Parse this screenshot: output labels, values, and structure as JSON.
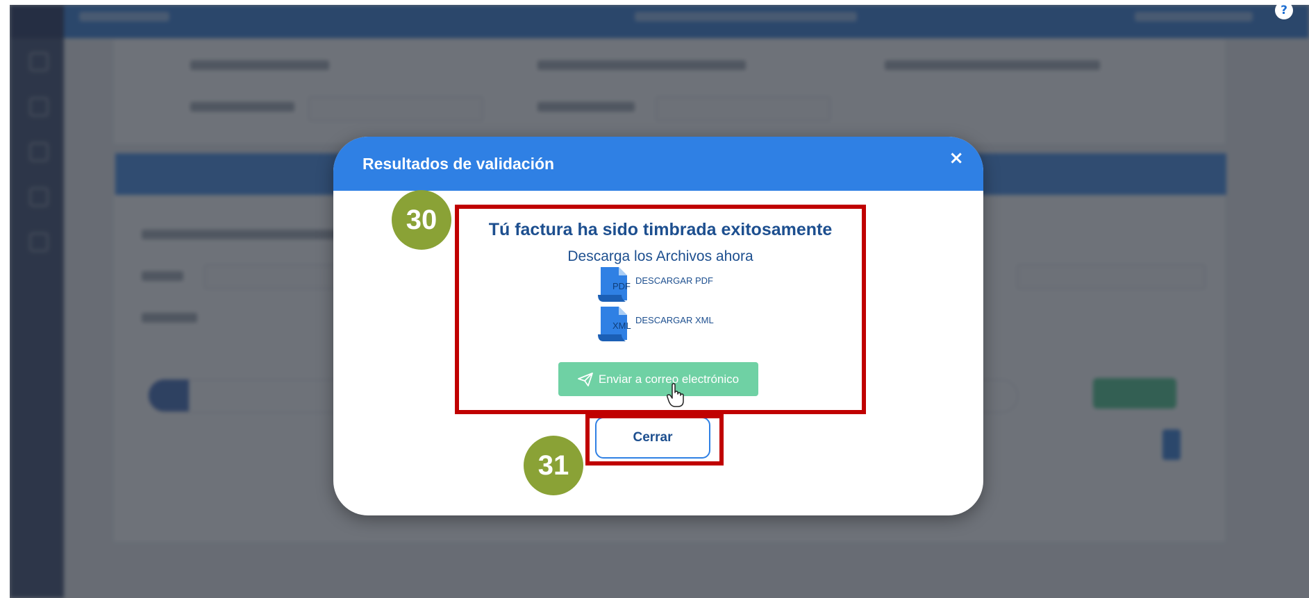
{
  "modal": {
    "title": "Resultados de validación",
    "close_symbol": "×",
    "success_message": "Tú factura ha sido timbrada exitosamente",
    "download_prompt": "Descarga los Archivos ahora",
    "downloads": [
      {
        "ext": "PDF",
        "label": "DESCARGAR PDF",
        "icon": "pdf-file-icon"
      },
      {
        "ext": "XML",
        "label": "DESCARGAR XML",
        "icon": "xml-file-icon"
      }
    ],
    "send_email_label": "Enviar a correo electrónico",
    "close_label": "Cerrar"
  },
  "annotations": {
    "step_30": "30",
    "step_31": "31"
  },
  "help_symbol": "?",
  "colors": {
    "header_blue": "#2f80e4",
    "highlight_red": "#c00000",
    "badge_green": "#8aa236",
    "send_green": "#6fd1a4",
    "text_navy": "#1d4f8f"
  }
}
